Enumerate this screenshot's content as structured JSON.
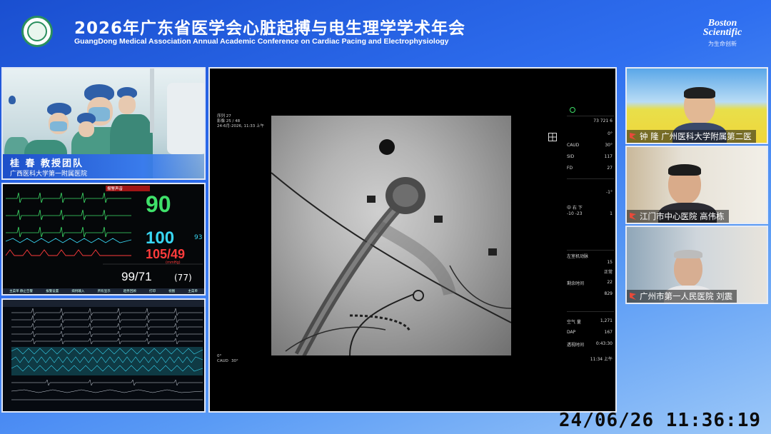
{
  "header": {
    "title_cn": "2026年广东省医学会心脏起搏与电生理学学术年会",
    "title_en": "GuangDong Medical Association Annual Academic Conference on Cardiac Pacing and Electrophysiology",
    "brand_name_1": "Boston",
    "brand_name_2": "Scientific",
    "brand_sub": "为生命创新"
  },
  "operating_room": {
    "name": "桂 春 教授团队",
    "hospital": "广西医科大学第一附属医院"
  },
  "vitals_monitor": {
    "alarm_text": "报警声音",
    "hr": "90",
    "spo2": "100",
    "spo2_small": "93",
    "nibp": "105/49",
    "nibp_unit": "(mmHg)",
    "art": "99/71",
    "art_mean": "(77)",
    "menu": [
      "主菜单 静止告警",
      "报警设置",
      "病例输入",
      "所有显示",
      "趋势回顾",
      "打印",
      "视图",
      "主菜单"
    ]
  },
  "fluoro": {
    "info_lines": [
      "序列 27",
      "影像 25 / 48",
      "24-6月-2026, 11:33 上午"
    ],
    "angle_lines": [
      "0°",
      "CAUD",
      "30°"
    ],
    "side_panel": {
      "rows": [
        {
          "label": "",
          "value": "73   721   6"
        },
        {
          "label": "",
          "value": "0°"
        },
        {
          "label": "CAUD",
          "value": "30°"
        },
        {
          "label": "SID",
          "value": "117"
        },
        {
          "label": "FD",
          "value": "27"
        },
        {
          "label": "",
          "value": "-1°"
        },
        {
          "label": "中   右   下",
          "value": ""
        },
        {
          "label": "-10   -23",
          "value": "1"
        },
        {
          "label": "左室机动脉",
          "value": ""
        },
        {
          "label": "",
          "value": "15"
        },
        {
          "label": "",
          "value": "正常"
        },
        {
          "label": "剩余时间",
          "value": "22"
        },
        {
          "label": "",
          "value": "829"
        },
        {
          "label": "空气 量",
          "value": "1,271"
        },
        {
          "label": "DAP",
          "value": "167"
        },
        {
          "label": "透视时间",
          "value": "0:43:30"
        },
        {
          "label": "",
          "value": "11:34 上午"
        }
      ]
    }
  },
  "participants": [
    {
      "label": "钟 隆  广州医科大学附属第二医",
      "bg": "#f0d63a"
    },
    {
      "label": "江门市中心医院 高伟栋",
      "bg": "#d8d4cc"
    },
    {
      "label": "广州市第一人民医院 刘震",
      "bg": "#cfd6dc"
    }
  ],
  "timestamp": "24/06/26 11:36:19",
  "colors": {
    "hr_green": "#3fe06a",
    "spo2_cyan": "#38d6f2",
    "nibp_red": "#ff3b3b",
    "header_blue": "#1a4fd0",
    "label_red": "#e84a3a"
  }
}
